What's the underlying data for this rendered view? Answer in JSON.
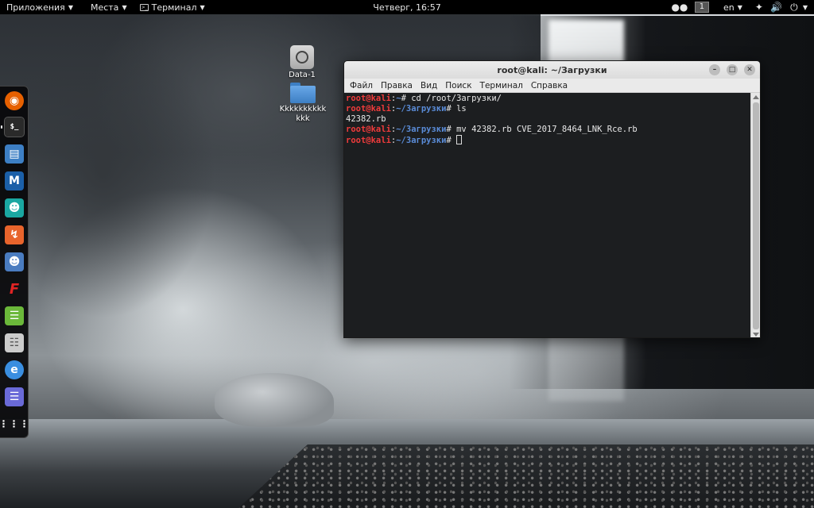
{
  "topbar": {
    "apps_menu": "Приложения",
    "places_menu": "Места",
    "terminal_menu": "Терминал",
    "clock": "Четверг, 16:57",
    "workspace": "1",
    "language": "en"
  },
  "dock": {
    "items": [
      {
        "name": "firefox",
        "color": "#e66000"
      },
      {
        "name": "terminal",
        "color": "#222222"
      },
      {
        "name": "files",
        "color": "#3d7fc4"
      },
      {
        "name": "metasploit",
        "color": "#1b5fa8"
      },
      {
        "name": "armitage",
        "color": "#1aa7a1"
      },
      {
        "name": "burpsuite",
        "color": "#e8642c"
      },
      {
        "name": "beef",
        "color": "#4a7cc0"
      },
      {
        "name": "faraday",
        "color": "#e02424"
      },
      {
        "name": "leafpad",
        "color": "#6bb83a"
      },
      {
        "name": "cherrytree",
        "color": "#cccccc"
      },
      {
        "name": "zenmap",
        "color": "#3a8ee0"
      },
      {
        "name": "notes",
        "color": "#6a6ad8"
      }
    ]
  },
  "desktop": {
    "icons": [
      {
        "label": "Data-1"
      },
      {
        "label": "Kkkkkkkkkkkkk"
      }
    ]
  },
  "terminal": {
    "title": "root@kali: ~/Загрузки",
    "menu": [
      "Файл",
      "Правка",
      "Вид",
      "Поиск",
      "Терминал",
      "Справка"
    ],
    "lines": [
      {
        "user": "root@kali",
        "path": "~",
        "cmd": "cd /root/Загрузки/"
      },
      {
        "user": "root@kali",
        "path": "~/Загрузки",
        "cmd": "ls"
      },
      {
        "output": "42382.rb"
      },
      {
        "user": "root@kali",
        "path": "~/Загрузки",
        "cmd": "mv 42382.rb CVE_2017_8464_LNK_Rce.rb"
      },
      {
        "user": "root@kali",
        "path": "~/Загрузки",
        "cmd": ""
      }
    ]
  }
}
